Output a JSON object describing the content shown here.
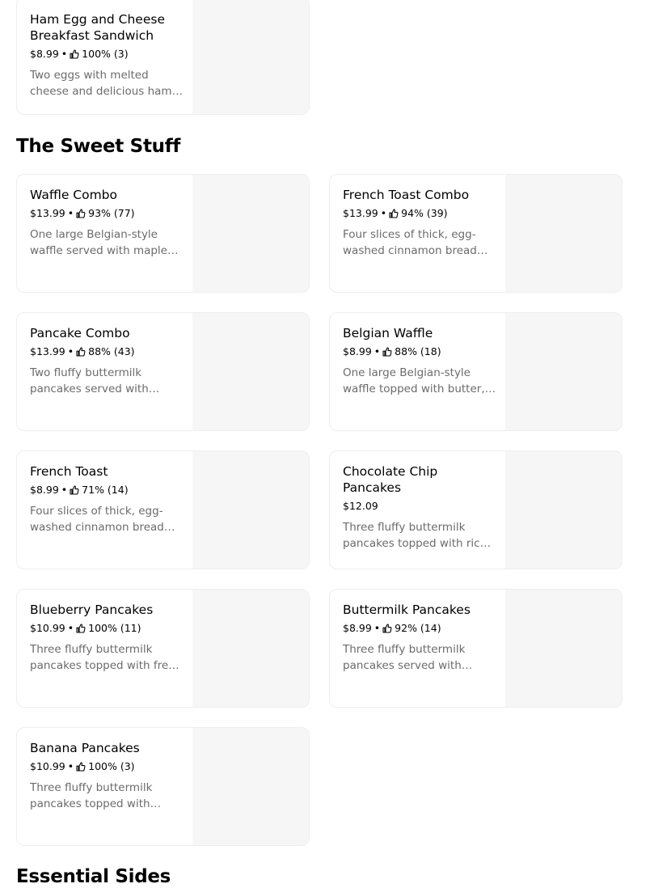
{
  "colors": {
    "card_border": "#eeeeee",
    "image_placeholder": "#f6f6f6",
    "muted_text": "#6b6b6b"
  },
  "sections": [
    {
      "title": "The Sweet Stuff"
    },
    {
      "title": "Essential Sides"
    }
  ],
  "items": [
    {
      "name": "Ham Egg and Cheese Breakfast Sandwich",
      "price": "$8.99",
      "rating": "100% (3)",
      "description": "Two eggs with melted cheese and delicious ham on a toasted bun."
    },
    {
      "name": "Waffle Combo",
      "price": "$13.99",
      "rating": "93% (77)",
      "description": "One large Belgian-style waffle served with maple syrup and butter."
    },
    {
      "name": "French Toast Combo",
      "price": "$13.99",
      "rating": "94% (39)",
      "description": "Four slices of thick, egg-washed cinnamon bread served with syrup."
    },
    {
      "name": "Pancake Combo",
      "price": "$13.99",
      "rating": "88% (43)",
      "description": "Two fluffy buttermilk pancakes served with maple syrup and butter."
    },
    {
      "name": "Belgian Waffle",
      "price": "$8.99",
      "rating": "88% (18)",
      "description": "One large Belgian-style waffle topped with butter, served with syrup."
    },
    {
      "name": "French Toast",
      "price": "$8.99",
      "rating": "71% (14)",
      "description": "Four slices of thick, egg-washed cinnamon bread served with syrup."
    },
    {
      "name": "Chocolate Chip Pancakes",
      "price": "$12.09",
      "rating": "",
      "description": "Three fluffy buttermilk pancakes topped with rich chocolate chips."
    },
    {
      "name": "Blueberry Pancakes",
      "price": "$10.99",
      "rating": "100% (11)",
      "description": "Three fluffy buttermilk pancakes topped with fresh blueberries."
    },
    {
      "name": "Buttermilk Pancakes",
      "price": "$8.99",
      "rating": "92% (14)",
      "description": "Three fluffy buttermilk pancakes served with maple syrup and butter."
    },
    {
      "name": "Banana Pancakes",
      "price": "$10.99",
      "rating": "100% (3)",
      "description": "Three fluffy buttermilk pancakes topped with sliced bananas."
    }
  ]
}
